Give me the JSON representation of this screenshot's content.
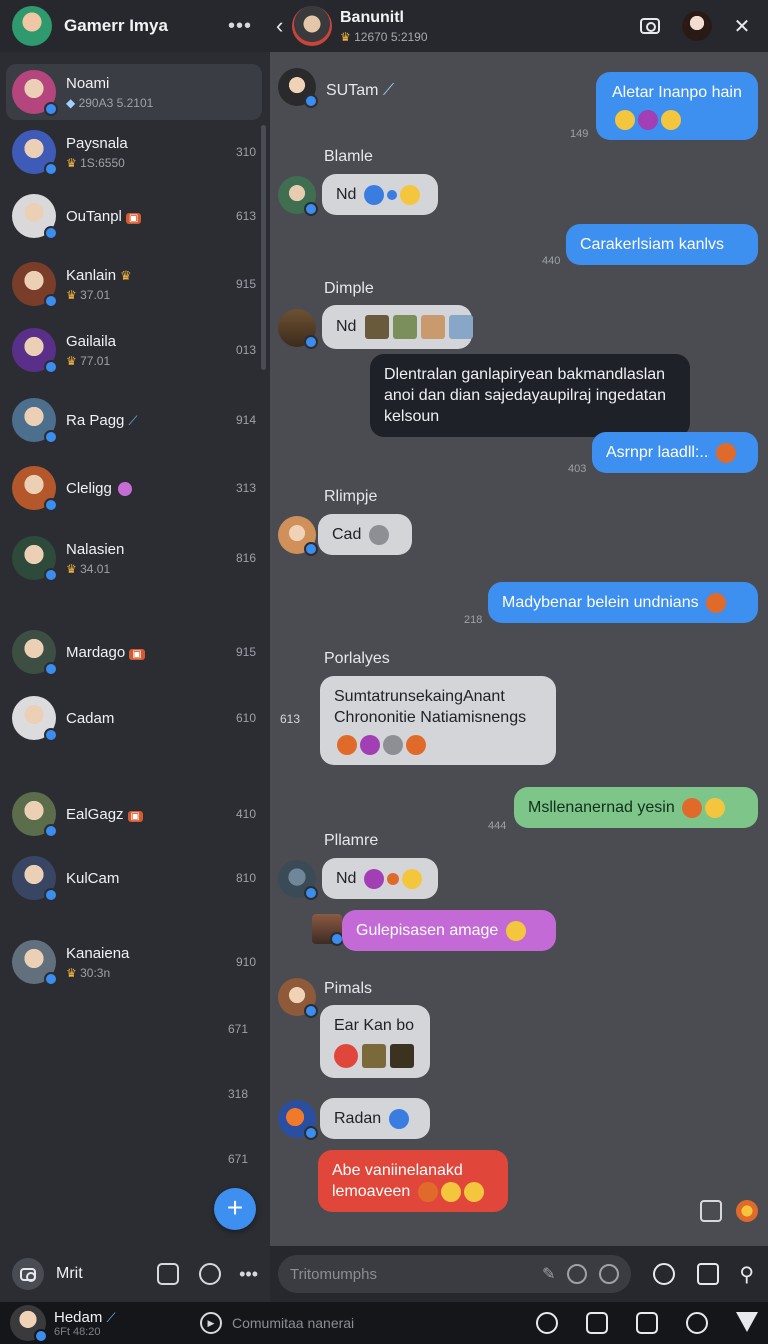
{
  "sidebar": {
    "title": "Gamerr Imya",
    "menu_label": "•••",
    "chats": [
      {
        "name": "Noami",
        "sub": "290A3 5.2101",
        "sub_icon": "diamond",
        "time": "",
        "active": true,
        "badge": "",
        "avatar_color": "#b4457d"
      },
      {
        "name": "Paysnala",
        "sub": "1S:6550",
        "sub_icon": "crown",
        "time": "310",
        "badge": "",
        "avatar_color": "#3f5bb8"
      },
      {
        "name": "OuTanpl",
        "sub": "",
        "time": "613",
        "badge": "red",
        "avatar_color": "#d9d9dc"
      },
      {
        "name": "Kanlain",
        "sub": "37.01",
        "sub_icon": "crown",
        "time": "915",
        "badge": "crown",
        "avatar_color": "#7a3d2a"
      },
      {
        "name": "Gailaila",
        "sub": "77.01",
        "sub_icon": "crown",
        "time": "013",
        "badge": "",
        "avatar_color": "#5a2f8a"
      },
      {
        "name": "Ra Pagg",
        "sub": "",
        "time": "914",
        "badge": "blue",
        "avatar_color": "#4d6f8e"
      },
      {
        "name": "Cleligg",
        "sub": "",
        "time": "313",
        "badge": "purple",
        "avatar_color": "#b4582c"
      },
      {
        "name": "Nalasien",
        "sub": "34.01",
        "sub_icon": "crown",
        "time": "816",
        "badge": "",
        "avatar_color": "#2d4a3a"
      },
      {
        "name": "Mardago",
        "sub": "",
        "time": "915",
        "badge": "red",
        "avatar_color": "#3d4e43"
      },
      {
        "name": "Cadam",
        "sub": "",
        "time": "610",
        "badge": "",
        "avatar_color": "#dcdcdf"
      },
      {
        "name": "EalGagz",
        "sub": "",
        "time": "410",
        "badge": "red",
        "avatar_color": "#5b6d4a"
      },
      {
        "name": "KulCam",
        "sub": "",
        "time": "810",
        "badge": "",
        "avatar_color": "#394663"
      },
      {
        "name": "Kanaiena",
        "sub": "30:3n",
        "sub_icon": "crown",
        "time": "910",
        "badge": "",
        "avatar_color": "#62707e"
      }
    ],
    "extra_times": [
      "671",
      "318",
      "671"
    ],
    "fab_label": "+"
  },
  "header": {
    "back_label": "‹",
    "name": "Banunitl",
    "sub": "12670 5:2190",
    "close_label": "✕"
  },
  "messages": {
    "m1": {
      "sender": "SUTam",
      "direction": "in"
    },
    "m2": {
      "text": "Aletar Inanpo hain",
      "time": "149",
      "direction": "out"
    },
    "m3": {
      "sender": "Blamle",
      "text": "Nd",
      "direction": "in"
    },
    "m4": {
      "text": "Carakerlsiam kanlvs",
      "time": "440",
      "direction": "out"
    },
    "m5": {
      "sender": "Dimple",
      "text": "Nd",
      "direction": "in"
    },
    "m6": {
      "text": "Dlentralan ganlapiryean bakmandlaslan anoi dan dian sajedayaupilraj ingedatan kelsoun",
      "direction": "in"
    },
    "m7": {
      "text": "Asrnpr laadll:..",
      "time": "403",
      "direction": "out"
    },
    "m8": {
      "sender": "Rlimpje",
      "text": "Cad",
      "direction": "in"
    },
    "m9": {
      "text": "Madybenar belein undnians",
      "time": "218",
      "direction": "out"
    },
    "m10": {
      "sender": "Porlalyes",
      "text_line1": "SumtatrunsekaingAnant",
      "text_line2": "Chrononitie Natiamisnengs",
      "side_time": "613",
      "direction": "in"
    },
    "m11": {
      "text": "Msllenanernad yesin",
      "time": "444",
      "direction": "out"
    },
    "m12": {
      "sender": "Pllamre",
      "text": "Nd",
      "direction": "in"
    },
    "m13": {
      "text": "Gulepisasen amage",
      "direction": "in"
    },
    "m14": {
      "sender": "Pimals",
      "text": "Ear Kan bo",
      "direction": "in"
    },
    "m15": {
      "text": "Radan",
      "direction": "in"
    },
    "m16": {
      "text_line1": "Abe vaniinelanakd",
      "text_line2": "lemoaveen",
      "direction": "in"
    }
  },
  "left_toolbar": {
    "label": "Mrit",
    "menu_label": "•••"
  },
  "composer": {
    "placeholder": "Tritomumphs"
  },
  "bottom_bar": {
    "user_name": "Hedam",
    "user_sub": "6Ft 48:20",
    "status_text": "Comumitaa nanerai"
  },
  "colors": {
    "accent_blue": "#3d8ff0",
    "green_bubble": "#7ec58a",
    "purple_bubble": "#c36ad6",
    "red_bubble": "#e0473a"
  }
}
